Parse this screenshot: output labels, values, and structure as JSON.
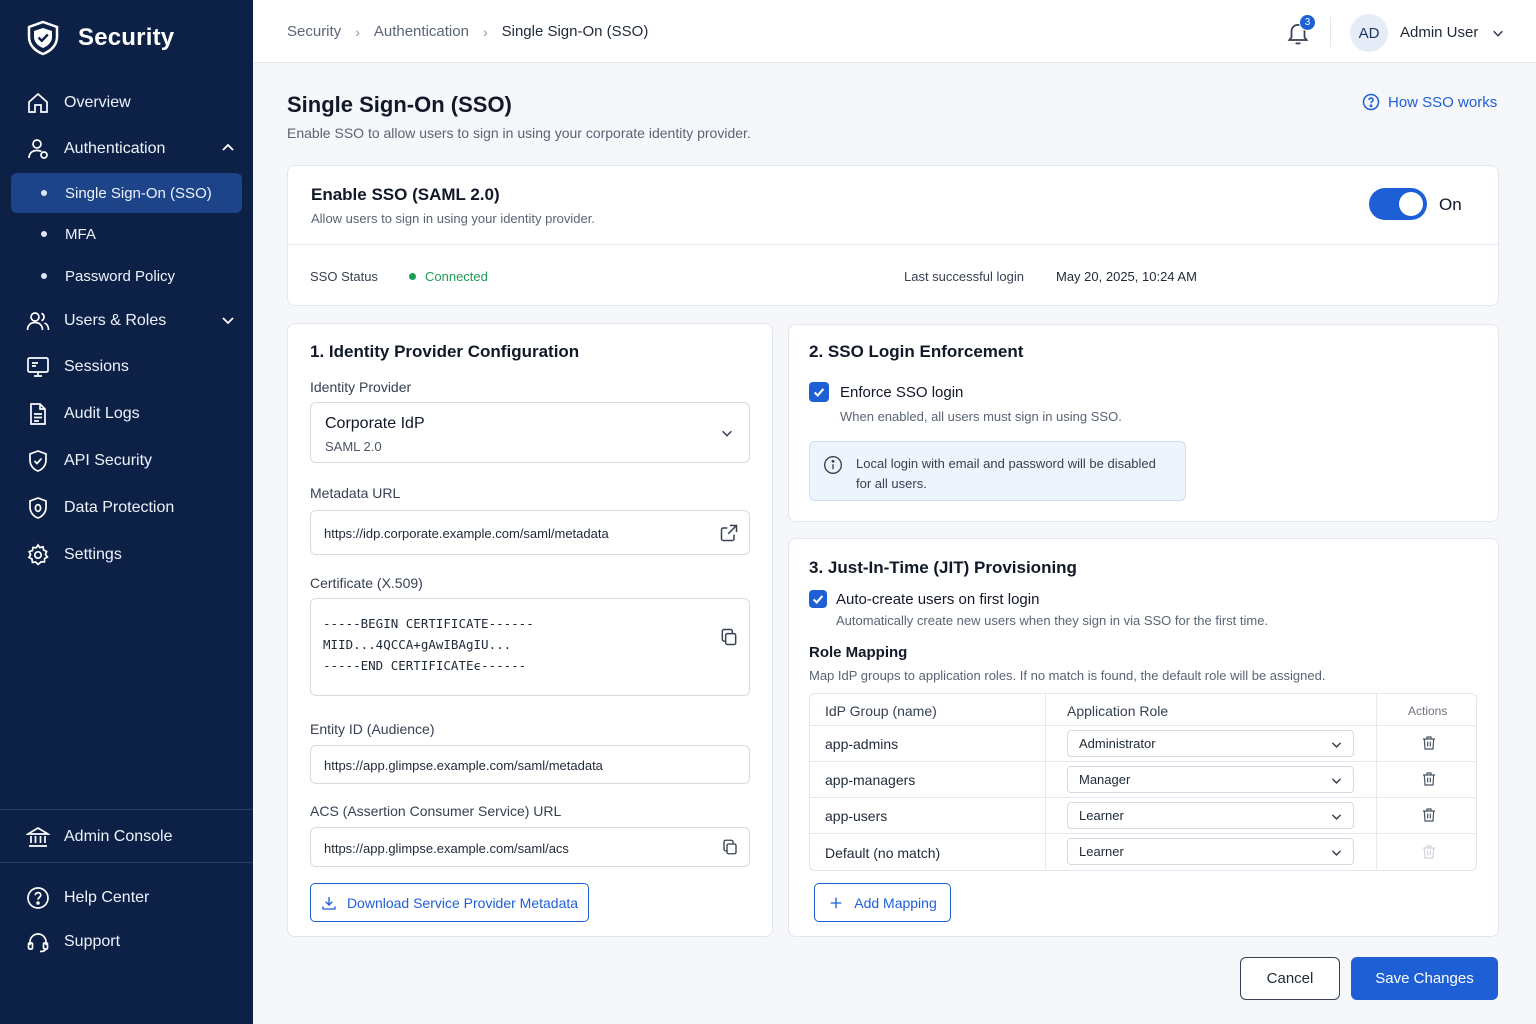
{
  "colors": {
    "sidebar_bg": "#0d2147",
    "sidebar_active": "#1d4389",
    "accent": "#1f5fd6",
    "success": "#1f9d55"
  },
  "sidebar": {
    "brand": "Security",
    "items": [
      {
        "label": "Overview",
        "icon": "home-icon"
      },
      {
        "label": "Authentication",
        "icon": "user-icon",
        "expanded": true
      },
      {
        "label": "Users & Roles",
        "icon": "users-icon"
      },
      {
        "label": "Sessions",
        "icon": "monitor-icon"
      },
      {
        "label": "Audit Logs",
        "icon": "document-icon"
      },
      {
        "label": "API Security",
        "icon": "shield-check-icon"
      },
      {
        "label": "Data Protection",
        "icon": "shield-icon"
      },
      {
        "label": "Settings",
        "icon": "gear-icon"
      }
    ],
    "sub_items": [
      {
        "label": "Single Sign-On (SSO)",
        "active": true
      },
      {
        "label": "MFA"
      },
      {
        "label": "Password Policy"
      }
    ],
    "admin_console": "Admin Console",
    "help_center": "Help Center",
    "support": "Support"
  },
  "header": {
    "breadcrumb": [
      "Security",
      "Authentication",
      "Single Sign-On (SSO)"
    ],
    "notification_count": "3",
    "user_initials": "AD",
    "user_name": "Admin User"
  },
  "page": {
    "title": "Single Sign-On (SSO)",
    "subtitle": "Enable SSO to allow users to sign in using your corporate identity provider.",
    "help_link": "How SSO works"
  },
  "enable_card": {
    "title": "Enable SSO (SAML 2.0)",
    "description": "Allow users to sign in using your identity provider.",
    "toggle_label": "On",
    "toggle_on": true,
    "status_label": "SSO Status",
    "status_value": "Connected",
    "last_login_label": "Last successful login",
    "last_login_value": "May 20, 2025, 10:24 AM"
  },
  "idp_config": {
    "title": "1. Identity Provider Configuration",
    "provider_label": "Identity Provider",
    "provider_value": "Corporate IdP",
    "provider_type": "SAML 2.0",
    "metadata_label": "Metadata URL",
    "metadata_value": "https://idp.corporate.example.com/saml/metadata",
    "cert_label": "Certificate (X.509)",
    "cert_lines": [
      "-----BEGIN CERTIFICATE------",
      "MIID...4QCCA+gAwIBAgIU...",
      "-----END CERTIFICATEϵ------"
    ],
    "entity_label": "Entity ID (Audience)",
    "entity_value": "https://app.glimpse.example.com/saml/metadata",
    "acs_label": "ACS (Assertion Consumer Service) URL",
    "acs_value": "https://app.glimpse.example.com/saml/acs",
    "download_button": "Download Service Provider Metadata"
  },
  "enforcement": {
    "title": "2. SSO Login Enforcement",
    "checkbox_label": "Enforce SSO login",
    "checked": true,
    "helper": "When enabled, all users must sign in using SSO.",
    "info_line1": "Local login with email and password will be disabled",
    "info_line2": "for all users."
  },
  "jit": {
    "title": "3. Just-In-Time (JIT) Provisioning",
    "checkbox_label": "Auto-create users on first login",
    "checked": true,
    "helper": "Automatically create new users when they sign in via SSO for the first time.",
    "role_mapping_title": "Role Mapping",
    "role_mapping_desc": "Map IdP groups to application roles. If no match is found, the default role will be assigned.",
    "columns": [
      "IdP Group (name)",
      "Application Role",
      "Actions"
    ],
    "rows": [
      {
        "group": "app-admins",
        "role": "Administrator",
        "deletable": true
      },
      {
        "group": "app-managers",
        "role": "Manager",
        "deletable": true
      },
      {
        "group": "app-users",
        "role": "Learner",
        "deletable": true
      },
      {
        "group": "Default (no match)",
        "role": "Learner",
        "deletable": false
      }
    ],
    "add_button": "Add Mapping"
  },
  "footer": {
    "cancel": "Cancel",
    "save": "Save Changes"
  }
}
